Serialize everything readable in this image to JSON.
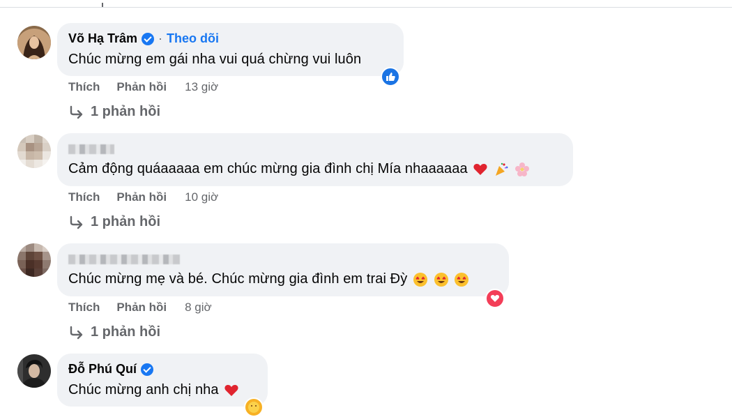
{
  "comments": [
    {
      "author": "Võ Hạ Trâm",
      "verified": true,
      "follow_label": "Theo dõi",
      "text": "Chúc mừng em gái nha vui quá chừng vui luôn",
      "reaction": "like-icon",
      "like_label": "Thích",
      "reply_label": "Phản hồi",
      "time": "13 giờ",
      "replies": "1 phản hồi"
    },
    {
      "author": "",
      "verified": false,
      "text": "Cảm động quáaaaaa em chúc mừng gia đình chị Mía nhaaaaaa",
      "emojis": [
        "red-heart-icon",
        "party-popper-icon",
        "cherry-blossom-icon"
      ],
      "like_label": "Thích",
      "reply_label": "Phản hồi",
      "time": "10 giờ",
      "replies": "1 phản hồi"
    },
    {
      "author": "",
      "verified": false,
      "text": "Chúc mừng mẹ và bé. Chúc mừng gia đình em trai Đỳ",
      "emojis": [
        "heart-eyes-icon",
        "heart-eyes-icon",
        "heart-eyes-icon"
      ],
      "reaction": "love-icon",
      "like_label": "Thích",
      "reply_label": "Phản hồi",
      "time": "8 giờ",
      "replies": "1 phản hồi"
    },
    {
      "author": "Đỗ Phú Quí",
      "verified": true,
      "text": "Chúc mừng anh chị nha",
      "emojis": [
        "red-heart-icon"
      ],
      "reaction": "care-icon"
    }
  ],
  "colors": {
    "bubble": "#f0f2f5",
    "link": "#1877f2",
    "secondary_text": "#65676b",
    "like": "#1b74e4",
    "love": "#f33e58"
  }
}
